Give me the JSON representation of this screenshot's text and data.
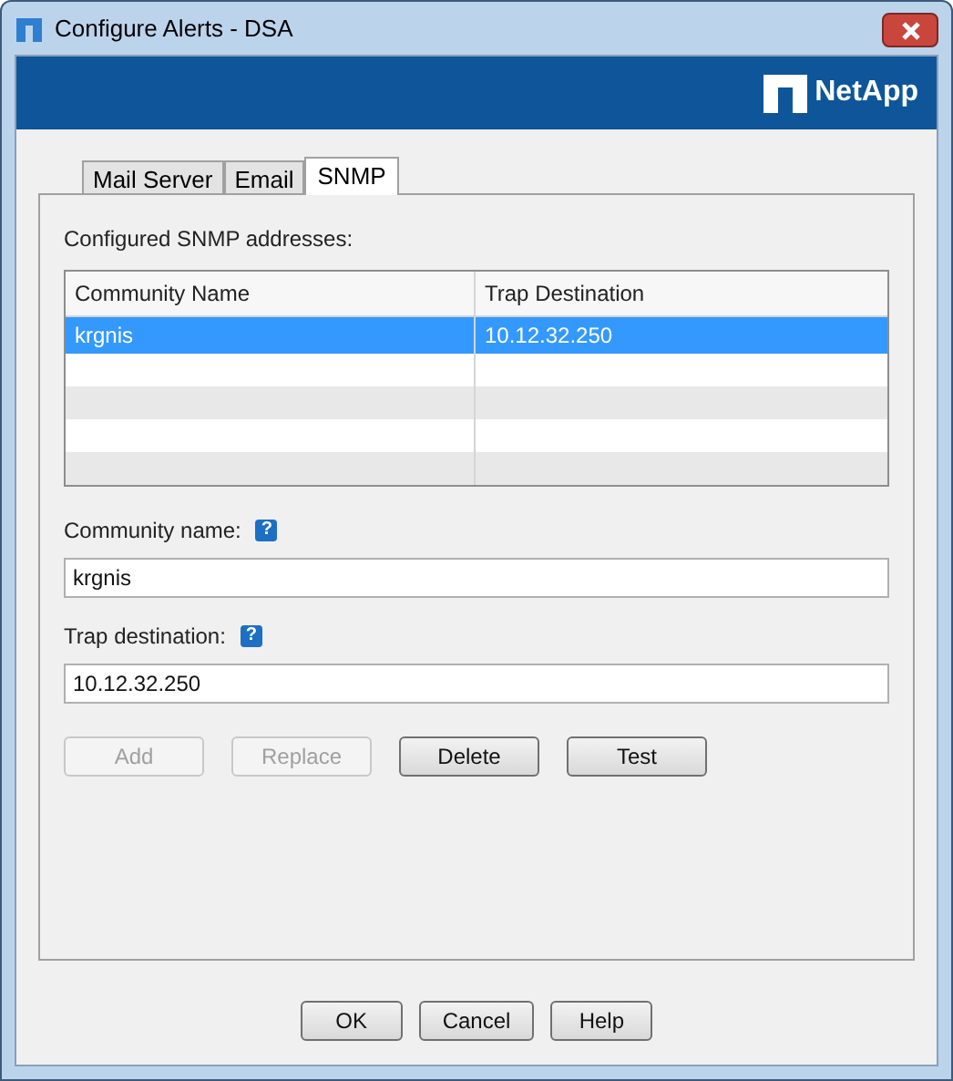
{
  "window": {
    "title": "Configure Alerts - DSA"
  },
  "banner": {
    "logo_text": "NetApp"
  },
  "tabs": [
    {
      "label": "Mail Server",
      "selected": false
    },
    {
      "label": "Email",
      "selected": false
    },
    {
      "label": "SNMP",
      "selected": true
    }
  ],
  "table": {
    "label": "Configured SNMP addresses:",
    "columns": [
      "Community Name",
      "Trap Destination"
    ],
    "rows": [
      {
        "cells": [
          "krgnis",
          "10.12.32.250"
        ],
        "selected": true
      }
    ]
  },
  "fields": [
    {
      "label": "Community name:",
      "help": "?",
      "value": "krgnis"
    },
    {
      "label": "Trap destination:",
      "help": "?",
      "value": "10.12.32.250"
    }
  ],
  "actions": [
    {
      "label": "Add",
      "disabled": true
    },
    {
      "label": "Replace",
      "disabled": true
    },
    {
      "label": "Delete",
      "disabled": false
    },
    {
      "label": "Test",
      "disabled": false
    }
  ],
  "buttons": [
    "OK",
    "Cancel",
    "Help"
  ]
}
